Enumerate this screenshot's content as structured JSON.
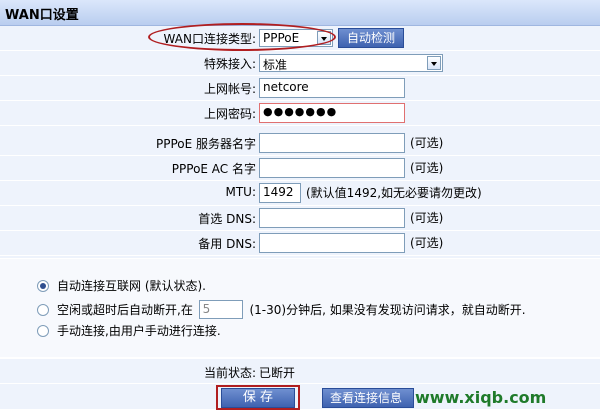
{
  "header": {
    "title": "WAN口设置"
  },
  "form": {
    "wan_type_label": "WAN口连接类型:",
    "wan_type_value": "PPPoE",
    "auto_detect_label": "自动检测",
    "special_access_label": "特殊接入:",
    "special_access_value": "标准",
    "account_label": "上网帐号:",
    "account_value": "netcore",
    "password_label": "上网密码:",
    "password_value": "●●●●●●●",
    "server_name_label": "PPPoE 服务器名字",
    "server_name_hint": "(可选)",
    "ac_name_label": "PPPoE AC 名字",
    "ac_name_hint": "(可选)",
    "mtu_label": "MTU:",
    "mtu_value": "1492",
    "mtu_hint": "(默认值1492,如无必要请勿更改)",
    "dns1_label": "首选 DNS:",
    "dns1_hint": "(可选)",
    "dns2_label": "备用 DNS:",
    "dns2_hint": "(可选)"
  },
  "connect_mode": {
    "auto_label": "自动连接互联网 (默认状态).",
    "idle_prefix": "空闲或超时后自动断开,在",
    "idle_value": "5",
    "idle_suffix": "(1-30)分钟后, 如果没有发现访问请求，就自动断开.",
    "manual_label": "手动连接,由用户手动进行连接."
  },
  "status": {
    "label": "当前状态:",
    "value": "已断开"
  },
  "buttons": {
    "save_label": "保 存",
    "view_label": "查看连接信息"
  },
  "watermark": "www.xiqb.com"
}
